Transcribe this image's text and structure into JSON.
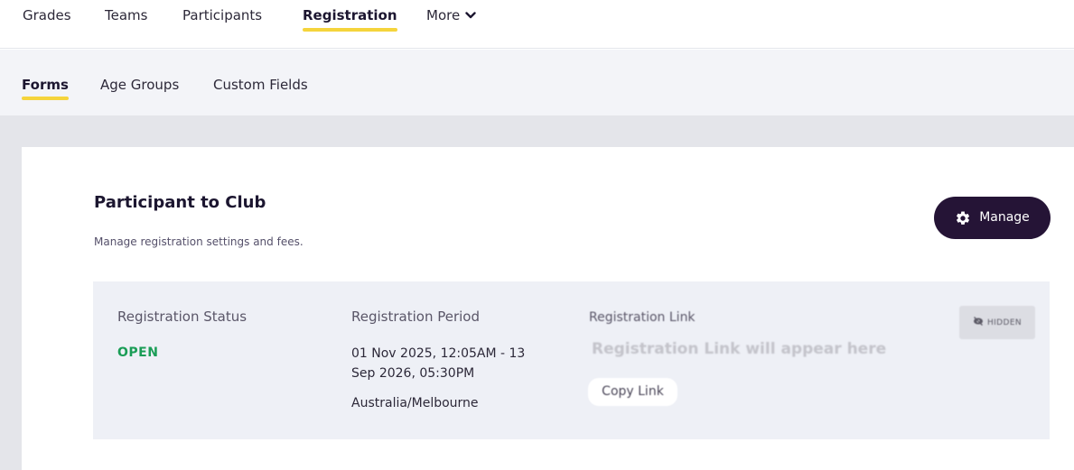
{
  "top_nav": {
    "items": [
      {
        "label": "Grades"
      },
      {
        "label": "Teams"
      },
      {
        "label": "Participants"
      },
      {
        "label": "Registration",
        "active": true
      },
      {
        "label": "More",
        "has_dropdown": true
      }
    ]
  },
  "sub_nav": {
    "items": [
      {
        "label": "Forms",
        "active": true
      },
      {
        "label": "Age Groups"
      },
      {
        "label": "Custom Fields"
      }
    ]
  },
  "card": {
    "title": "Participant to Club",
    "description": "Manage registration settings and fees.",
    "manage_button": {
      "label": "Manage",
      "icon": "gear-icon"
    },
    "registration_status": {
      "label": "Registration Status",
      "value": "OPEN"
    },
    "registration_period": {
      "label": "Registration Period",
      "value": "01 Nov 2025, 12:05AM - 13 Sep 2026, 05:30PM",
      "timezone": "Australia/Melbourne"
    },
    "registration_link": {
      "label": "Registration Link",
      "placeholder": "Registration Link will appear here",
      "copy_label": "Copy Link"
    },
    "visibility_badge": {
      "label": "HIDDEN",
      "icon": "eye-off-icon"
    }
  },
  "colors": {
    "accent_underline": "#f5d43c",
    "manage_button_bg": "#251436",
    "status_open": "#1a9d56",
    "panel_bg": "#eef0f6"
  }
}
